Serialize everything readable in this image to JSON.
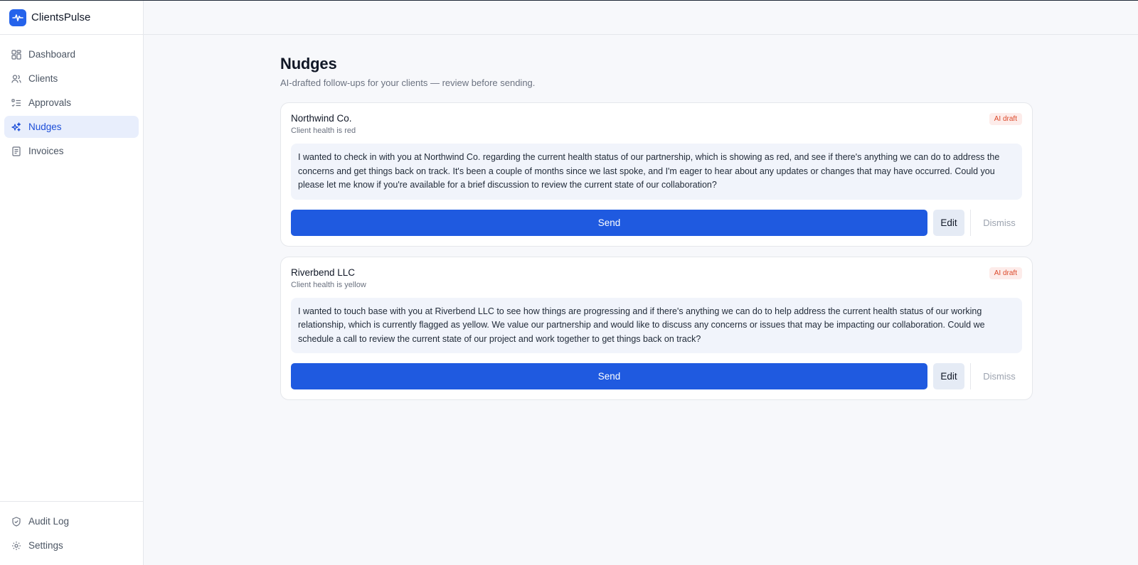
{
  "brand": {
    "name": "ClientsPulse",
    "logo_icon": "pulse-icon",
    "accent": "#2563eb"
  },
  "sidebar": {
    "items": [
      {
        "label": "Dashboard",
        "icon": "grid-icon",
        "active": false
      },
      {
        "label": "Clients",
        "icon": "users-icon",
        "active": false
      },
      {
        "label": "Approvals",
        "icon": "checklist-icon",
        "active": false
      },
      {
        "label": "Nudges",
        "icon": "sparkles-icon",
        "active": true
      },
      {
        "label": "Invoices",
        "icon": "invoice-icon",
        "active": false
      }
    ],
    "bottom_items": [
      {
        "label": "Audit Log",
        "icon": "shield-icon"
      },
      {
        "label": "Settings",
        "icon": "gear-icon"
      }
    ]
  },
  "page": {
    "title": "Nudges",
    "subtitle": "AI-drafted follow-ups for your clients — review before sending."
  },
  "nudges": [
    {
      "client": "Northwind Co.",
      "health": "Client health is red",
      "badge": "AI draft",
      "message": "I wanted to check in with you at Northwind Co. regarding the current health status of our partnership, which is showing as red, and see if there's anything we can do to address the concerns and get things back on track. It's been a couple of months since we last spoke, and I'm eager to hear about any updates or changes that may have occurred. Could you please let me know if you're available for a brief discussion to review the current state of our collaboration?",
      "send_label": "Send",
      "edit_label": "Edit",
      "dismiss_label": "Dismiss"
    },
    {
      "client": "Riverbend LLC",
      "health": "Client health is yellow",
      "badge": "AI draft",
      "message": "I wanted to touch base with you at Riverbend LLC to see how things are progressing and if there's anything we can do to help address the current health status of our working relationship, which is currently flagged as yellow. We value our partnership and would like to discuss any concerns or issues that may be impacting our collaboration. Could we schedule a call to review the current state of our project and work together to get things back on track?",
      "send_label": "Send",
      "edit_label": "Edit",
      "dismiss_label": "Dismiss"
    }
  ],
  "colors": {
    "send_button": "#1f5ae0",
    "badge_text": "#dc4a2b",
    "active_nav_bg": "#e8eefc"
  }
}
